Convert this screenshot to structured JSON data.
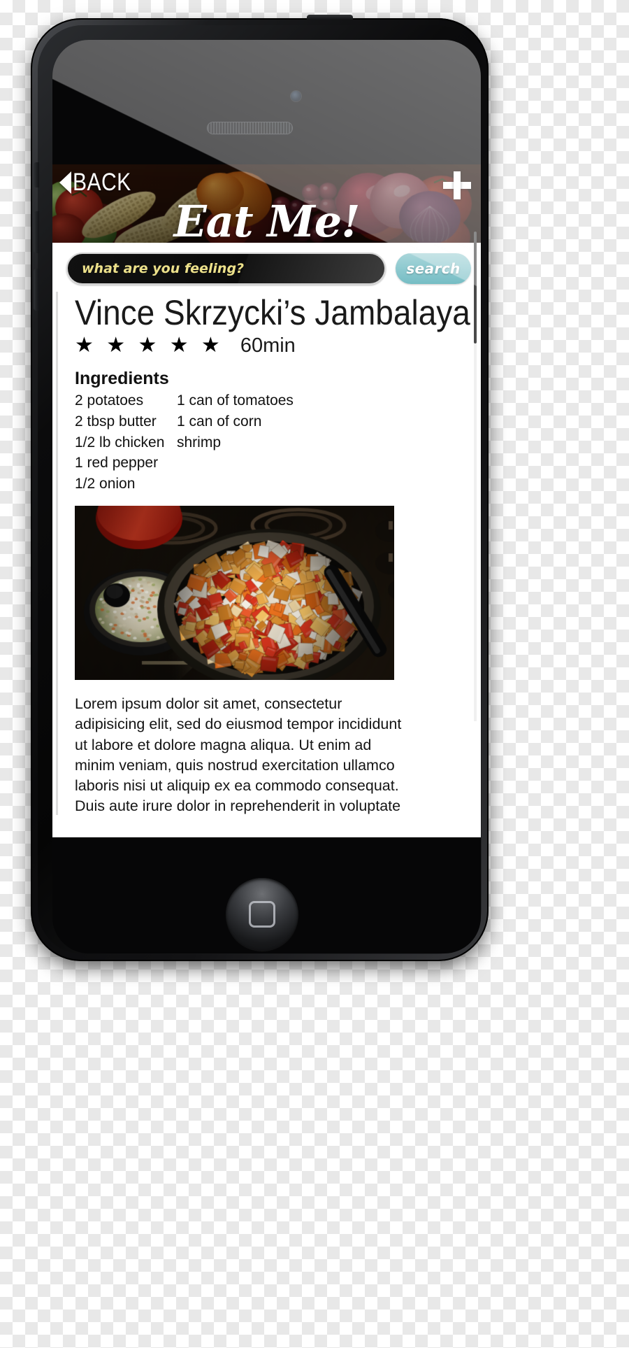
{
  "app": {
    "title": "Eat Me!",
    "back_label": "BACK",
    "add_label": "+"
  },
  "search": {
    "placeholder": "what are you feeling?",
    "value": "",
    "button_label": "search",
    "button_color": "#8fcad0"
  },
  "recipe": {
    "title": "Vince Skrzycki’s Jambalaya",
    "stars": "★ ★ ★ ★ ★",
    "rating_value": 5,
    "cook_time": "60min",
    "ingredients_heading": "Ingredients",
    "ingredients_left": [
      "2 potatoes",
      "2 tbsp butter",
      "1/2 lb chicken",
      "1 red pepper",
      "1/2 onion"
    ],
    "ingredients_right": [
      "1 can of tomatoes",
      "1 can of corn",
      "shrimp"
    ],
    "photo_alt": "skillet of diced potatoes peppers and onions on a stove",
    "body": "Lorem ipsum dolor sit amet, consectetur adipisicing elit, sed do eiusmod tempor incididunt ut labore et dolore magna aliqua. Ut enim ad minim veniam, quis nostrud exercitation ullamco laboris nisi ut aliquip ex ea commodo consequat. Duis aute irure dolor in reprehenderit in voluptate velit esse cillum dolore eu fugiat nulla pariatur. Excepteur sint occaecat cupidatat"
  },
  "icons": {
    "back": "back-arrow-icon",
    "add": "plus-icon",
    "camera": "camera-icon",
    "speaker": "speaker-grille-icon",
    "home": "home-button-icon"
  }
}
